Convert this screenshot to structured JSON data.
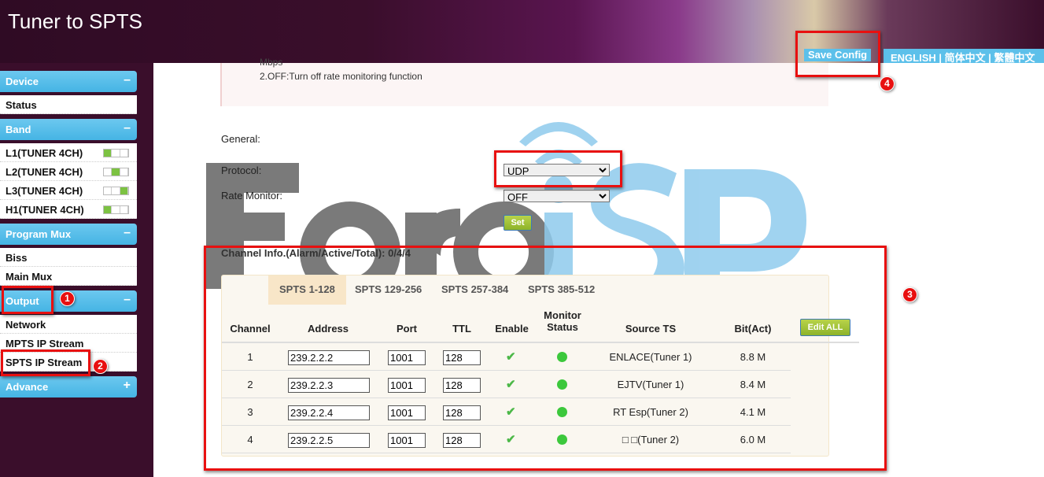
{
  "header": {
    "title": "Tuner to SPTS",
    "save_config": "Save Config",
    "languages": "ENGLISH | 简体中文 | 繁體中文"
  },
  "sidebar": {
    "device": {
      "label": "Device",
      "toggle": "–",
      "items": [
        "Status"
      ]
    },
    "band": {
      "label": "Band",
      "toggle": "–",
      "items": [
        {
          "label": "L1(TUNER 4CH)",
          "active_slot": 1
        },
        {
          "label": "L2(TUNER 4CH)",
          "active_slot": 2
        },
        {
          "label": "L3(TUNER 4CH)",
          "active_slot": 3
        },
        {
          "label": "H1(TUNER 4CH)",
          "active_slot": 1
        }
      ]
    },
    "program_mux": {
      "label": "Program Mux",
      "toggle": "–",
      "items": [
        "Biss",
        "Main Mux"
      ]
    },
    "output": {
      "label": "Output",
      "toggle": "–",
      "items": [
        "Network",
        "MPTS IP Stream",
        "SPTS IP Stream"
      ]
    },
    "advance": {
      "label": "Advance",
      "toggle": "+"
    }
  },
  "note": {
    "cut_line": "Mbps",
    "line2": "2.OFF:Turn off rate monitoring function"
  },
  "general": {
    "label": "General:",
    "protocol_label": "Protocol:",
    "protocol_value": "UDP",
    "rate_label": "Rate Monitor:",
    "rate_value": "OFF",
    "set": "Set"
  },
  "channel_info": "Channel Info.(Alarm/Active/Total): 0/4/4",
  "tabs": [
    "SPTS 1-128",
    "SPTS 129-256",
    "SPTS 257-384",
    "SPTS 385-512"
  ],
  "table": {
    "headers": [
      "Channel",
      "Address",
      "Port",
      "TTL",
      "Enable",
      "Monitor Status",
      "Source TS",
      "Bit(Act)"
    ],
    "edit_all": "Edit ALL",
    "rows": [
      {
        "channel": "1",
        "address": "239.2.2.2",
        "port": "1001",
        "ttl": "128",
        "enable": "✔",
        "source": "ENLACE(Tuner 1)",
        "bit": "8.8 M"
      },
      {
        "channel": "2",
        "address": "239.2.2.3",
        "port": "1001",
        "ttl": "128",
        "enable": "✔",
        "source": "EJTV(Tuner 1)",
        "bit": "8.4 M"
      },
      {
        "channel": "3",
        "address": "239.2.2.4",
        "port": "1001",
        "ttl": "128",
        "enable": "✔",
        "source": "RT Esp(Tuner 2)",
        "bit": "4.1 M"
      },
      {
        "channel": "4",
        "address": "239.2.2.5",
        "port": "1001",
        "ttl": "128",
        "enable": "✔",
        "source": "□ □(Tuner 2)",
        "bit": "6.0 M"
      }
    ]
  },
  "annotations": [
    "1",
    "2",
    "3",
    "4"
  ],
  "watermark": "ForoISP",
  "colors": {
    "accent": "#45b4e4",
    "background": "#3a0e2b",
    "annotation": "#e81010",
    "status_ok": "#3cc83c"
  }
}
